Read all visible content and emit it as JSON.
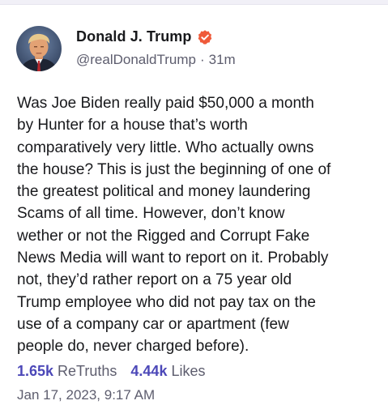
{
  "author": {
    "display_name": "Donald J. Trump",
    "handle": "@realDonaldTrump",
    "separator": "·",
    "time_ago": "31m",
    "verified_icon": "verified-badge-icon",
    "badge_color": "#ef5a3a"
  },
  "post": {
    "lines": [
      "Was Joe Biden really paid $50,000 a month",
      "by Hunter for a house that’s worth",
      "comparatively very little. Who actually owns",
      "the house? This is just the beginning of one of",
      "the greatest political and money laundering",
      "Scams of all time. However, don’t know",
      "wether or not the Rigged and Corrupt Fake",
      "News Media will want to report on it. Probably",
      "not, they’d rather report on a 75 year old",
      "Trump employee who did not pay tax on the",
      "use of a company car or apartment (few",
      "people do, never charged before)."
    ]
  },
  "stats": {
    "retruths_count": "1.65k",
    "retruths_label": "ReTruths",
    "likes_count": "4.44k",
    "likes_label": "Likes",
    "accent_color": "#4c48b8"
  },
  "timestamp": "Jan 17, 2023, 9:17 AM"
}
